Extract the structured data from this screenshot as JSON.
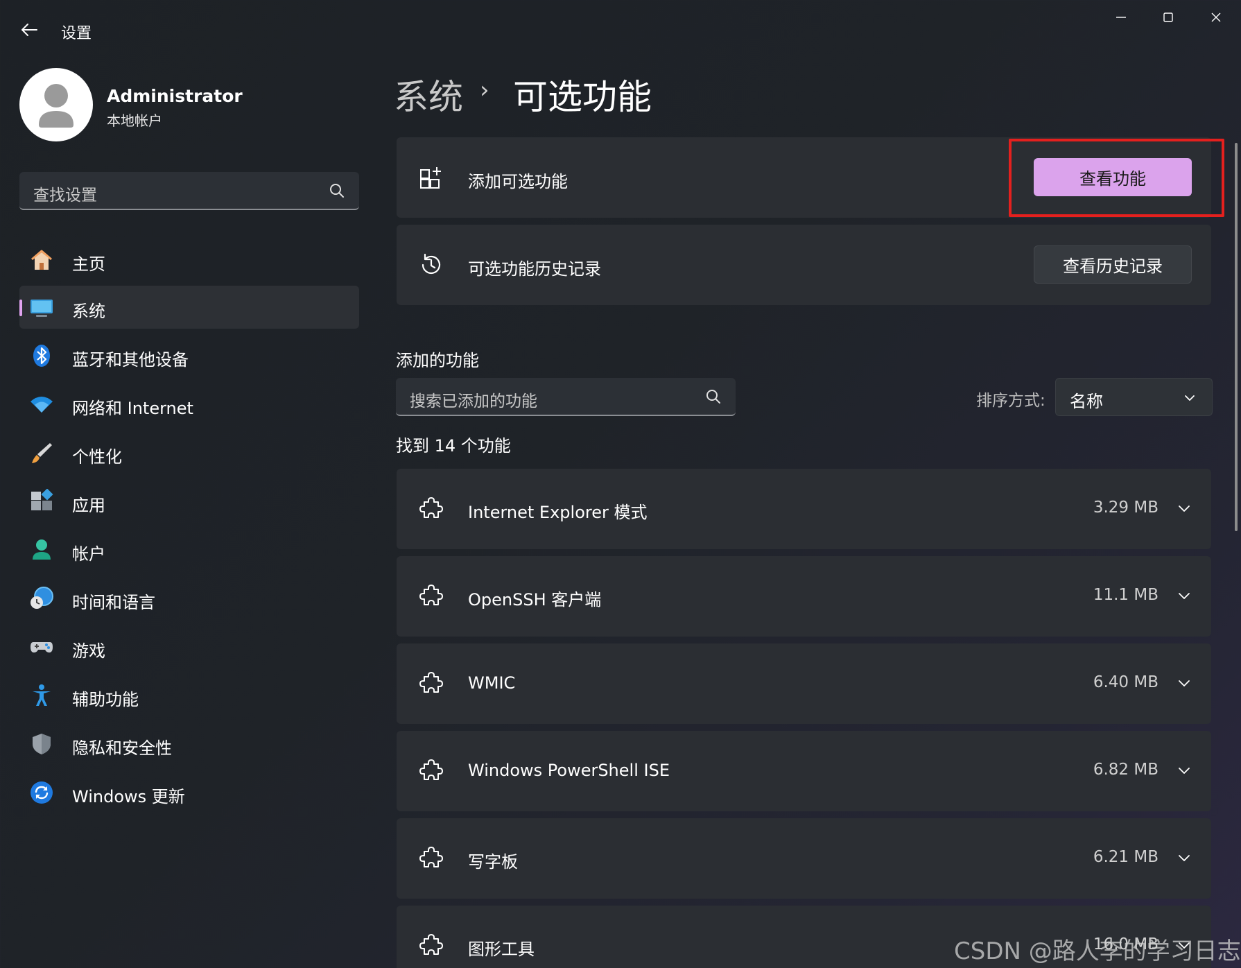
{
  "window": {
    "app_title": "设置",
    "back_icon": "arrow-left-icon",
    "controls": [
      "minimize-icon",
      "maximize-icon",
      "close-icon"
    ]
  },
  "profile": {
    "name": "Administrator",
    "account_type": "本地帐户"
  },
  "search": {
    "placeholder": "查找设置"
  },
  "nav": {
    "items": [
      {
        "label": "主页",
        "icon": "home-icon"
      },
      {
        "label": "系统",
        "icon": "system-display-icon",
        "active": true
      },
      {
        "label": "蓝牙和其他设备",
        "icon": "bluetooth-icon"
      },
      {
        "label": "网络和 Internet",
        "icon": "wifi-icon"
      },
      {
        "label": "个性化",
        "icon": "brush-icon"
      },
      {
        "label": "应用",
        "icon": "apps-icon"
      },
      {
        "label": "帐户",
        "icon": "account-icon"
      },
      {
        "label": "时间和语言",
        "icon": "time-language-icon"
      },
      {
        "label": "游戏",
        "icon": "gamepad-icon"
      },
      {
        "label": "辅助功能",
        "icon": "accessibility-icon"
      },
      {
        "label": "隐私和安全性",
        "icon": "shield-icon"
      },
      {
        "label": "Windows 更新",
        "icon": "update-icon"
      }
    ]
  },
  "breadcrumb": {
    "parent": "系统",
    "separator": "›",
    "current": "可选功能"
  },
  "cards": {
    "add": {
      "label": "添加可选功能",
      "button": "查看功能",
      "icon": "add-feature-icon"
    },
    "history": {
      "label": "可选功能历史记录",
      "button": "查看历史记录",
      "icon": "history-icon"
    }
  },
  "added": {
    "title": "添加的功能",
    "search_placeholder": "搜索已添加的功能",
    "sort_label": "排序方式:",
    "sort_value": "名称",
    "found_text": "找到 14 个功能",
    "features": [
      {
        "name": "Internet Explorer 模式",
        "size": "3.29 MB"
      },
      {
        "name": "OpenSSH 客户端",
        "size": "11.1 MB"
      },
      {
        "name": "WMIC",
        "size": "6.40 MB"
      },
      {
        "name": "Windows PowerShell ISE",
        "size": "6.82 MB"
      },
      {
        "name": "写字板",
        "size": "6.21 MB"
      },
      {
        "name": "图形工具",
        "size": "16.0 MB"
      }
    ]
  },
  "watermark": "CSDN @路人李的学习日志",
  "colors": {
    "accent": "#dba3ec",
    "highlight": "#e4201e",
    "card": "#2b2e33"
  }
}
